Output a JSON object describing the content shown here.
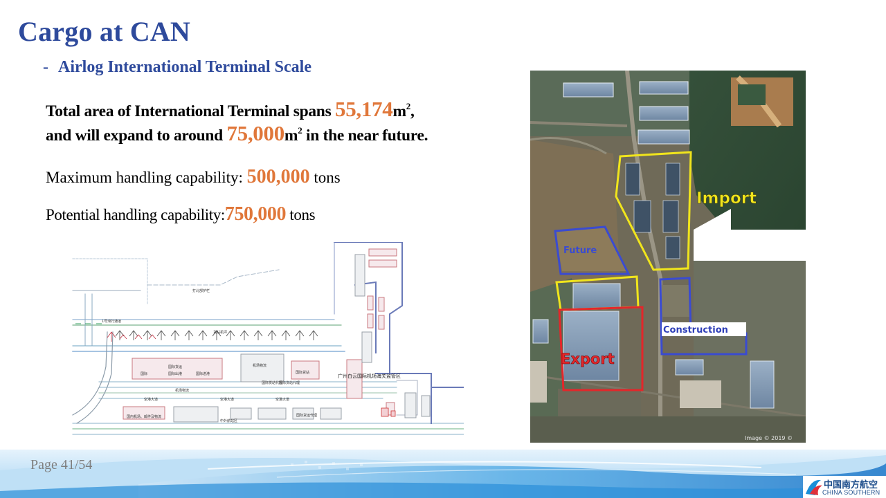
{
  "slide": {
    "title": "Cargo at CAN",
    "subtitle_dash": "-",
    "subtitle": "Airlog International Terminal  Scale"
  },
  "text": {
    "line1_a": "Total area of International Terminal spans ",
    "line1_value": "55,174",
    "line1_unit": "m",
    "line1_sup": "2",
    "line1_end": ",",
    "line2_a": "and will expand to around ",
    "line2_value": "75,000",
    "line2_unit": "m",
    "line2_sup": "2",
    "line2_end": " in the near future.",
    "max_label": "Maximum handling capability: ",
    "max_value": "500,000",
    "max_unit": " tons",
    "pot_label": "Potential handling capability:",
    "pot_value": "750,000",
    "pot_unit": " tons"
  },
  "satellite": {
    "labels": {
      "import": "Import",
      "future": "Future",
      "construction": "Construction",
      "export": "Export"
    },
    "credit": "Image © 2019 ©"
  },
  "plan": {
    "labels": {
      "top": "打北部护栏",
      "left_row": "1号滑行通道",
      "mid_strip": "货站机坪",
      "b1": "国际货运",
      "b1a": "国际",
      "b1b": "国际出港",
      "b1c": "国际进港",
      "b2": "机场物流",
      "b3": "国际货站",
      "b3a": "国际货站代理",
      "b3b": "国际货站代理",
      "b4": "机场物流",
      "road1": "空港大道",
      "road2": "空港大道",
      "road3": "空港大道",
      "b5": "国内机场、邮件及物流",
      "b6": "中外航站区",
      "b7": "国际货运代理",
      "right_big": "广州白云国际机场海关监管区"
    }
  },
  "footer": {
    "page": "Page 41/54",
    "logo_cn": "中国南方航空",
    "logo_en": "CHINA SOUTHERN"
  },
  "colors": {
    "title": "#2e4a9c",
    "highlight": "#e0773a",
    "import_outline": "#f1e51c",
    "future_outline": "#3a4bd1",
    "export_outline": "#e3262a"
  }
}
